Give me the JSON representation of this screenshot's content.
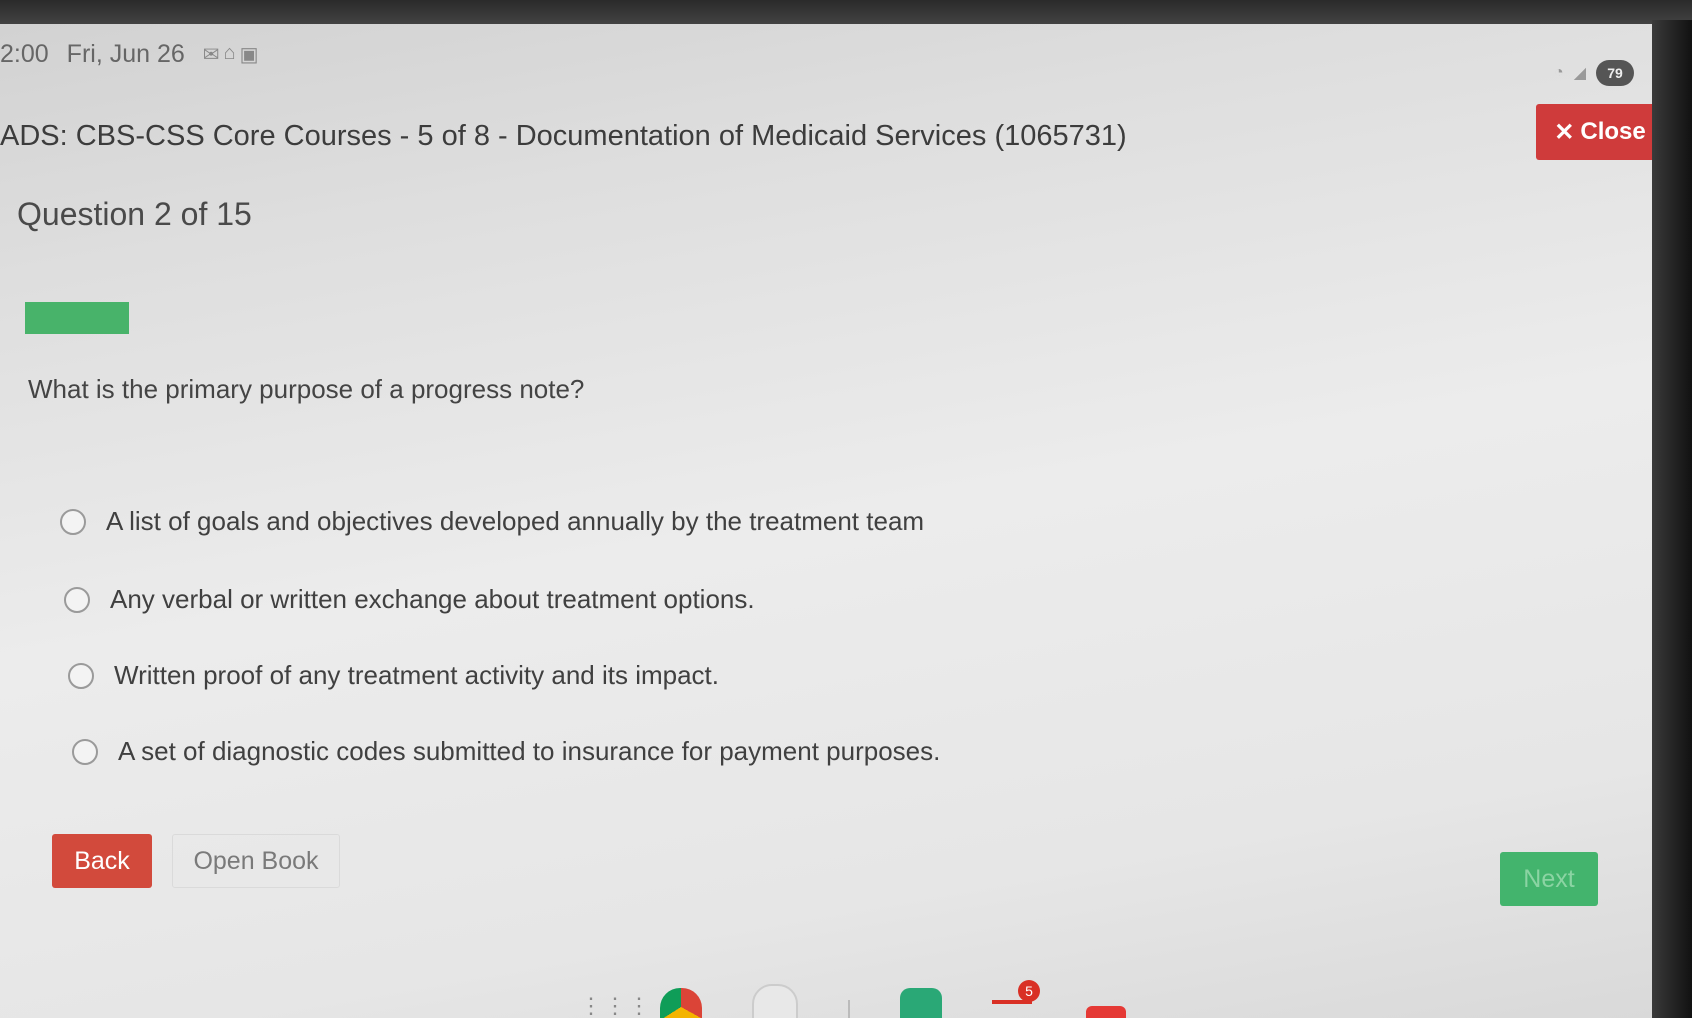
{
  "status_bar": {
    "time": "2:00",
    "date": "Fri, Jun 26",
    "battery": "79"
  },
  "header": {
    "title": "ADS: CBS-CSS Core Courses - 5 of 8 - Documentation of Medicaid Services (1065731)",
    "close_label": "Close",
    "close_color": "#cf3b3b"
  },
  "quiz": {
    "question_number": "Question 2 of  15",
    "progress": 0.066,
    "progress_color": "#48b36a",
    "question": "What is the primary purpose of a progress note?",
    "options": [
      "A list of goals and objectives developed annually by the treatment team",
      "Any verbal or written exchange about treatment options.",
      "Written proof of any treatment activity and its impact.",
      "A set of diagnostic codes submitted to insurance for payment purposes."
    ]
  },
  "buttons": {
    "back": "Back",
    "open_book": "Open Book",
    "next": "Next"
  },
  "taskbar": {
    "icons": [
      "launcher-icon",
      "chrome-icon",
      "camera-icon",
      "classroom-icon",
      "gmail-icon",
      "youtube-icon"
    ],
    "gmail_badge": "5"
  }
}
